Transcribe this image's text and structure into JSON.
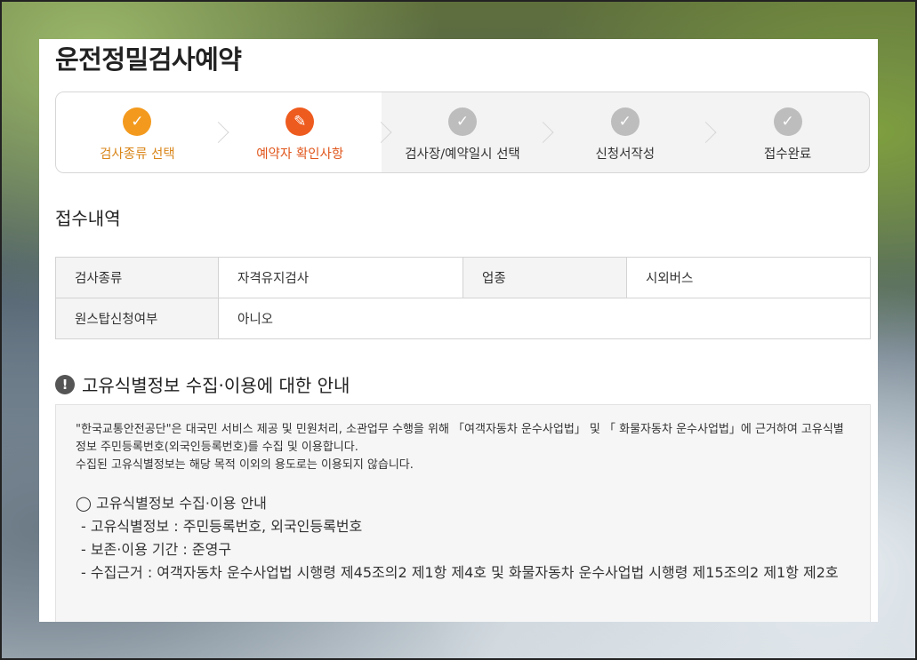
{
  "page": {
    "title": "운전정밀검사예약"
  },
  "steps": [
    {
      "label": "검사종류 선택",
      "state": "done",
      "icon": "check-icon"
    },
    {
      "label": "예약자 확인사항",
      "state": "active",
      "icon": "pencil-icon"
    },
    {
      "label": "검사장/예약일시 선택",
      "state": "pending",
      "icon": "check-icon"
    },
    {
      "label": "신청서작성",
      "state": "pending",
      "icon": "check-icon"
    },
    {
      "label": "접수완료",
      "state": "pending",
      "icon": "check-icon"
    }
  ],
  "colors": {
    "done": "#f39a1e",
    "active": "#ee5b1e",
    "pending": "#bdbdbd"
  },
  "receipt": {
    "title": "접수내역",
    "rows": [
      {
        "label1": "검사종류",
        "value1": "자격유지검사",
        "label2": "업종",
        "value2": "시외버스"
      },
      {
        "label1": "원스탑신청여부",
        "value1": "아니오"
      }
    ]
  },
  "notice": {
    "title": "고유식별정보 수집·이용에 대한 안내",
    "intro_line1": "\"한국교통안전공단\"은 대국민 서비스 제공 및 민원처리, 소관업무 수행을 위해 「여객자동차 운수사업법」 및 「 화물자동차 운수사업법」에 근거하여 고유식별정보 주민등록번호(외국인등록번호)를 수집 및 이용합니다.",
    "intro_line2": "수집된 고유식별정보는 해당 목적 이외의 용도로는 이용되지 않습니다.",
    "heading": "◯ 고유식별정보 수집·이용 안내",
    "items": [
      "- 고유식별정보 : 주민등록번호, 외국인등록번호",
      "- 보존·이용 기간 : 준영구",
      "- 수집근거 : 여객자동차 운수사업법 시행령 제45조의2 제1항 제4호 및 화물자동차 운수사업법 시행령 제15조의2 제1항 제2호"
    ]
  }
}
